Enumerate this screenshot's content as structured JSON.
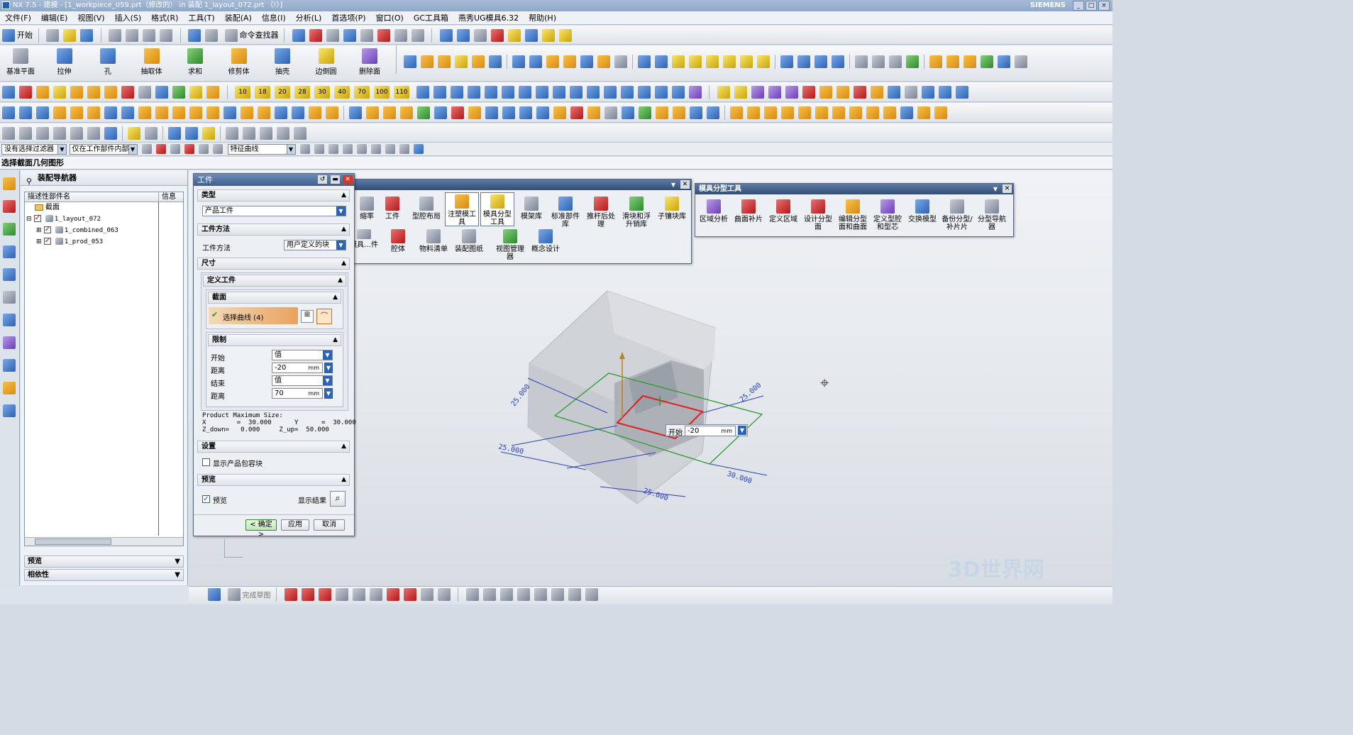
{
  "titlebar": {
    "title": "NX 7.5 - 建模 - [1_workpiece_059.prt（修改的） in 装配 1_layout_072.prt （!）]",
    "brand": "SIEMENS"
  },
  "menubar": [
    "文件(F)",
    "编辑(E)",
    "视图(V)",
    "插入(S)",
    "格式(R)",
    "工具(T)",
    "装配(A)",
    "信息(I)",
    "分析(L)",
    "首选项(P)",
    "窗口(O)",
    "GC工具箱",
    "燕秀UG模具6.32",
    "帮助(H)"
  ],
  "toolbar1": {
    "start": "开始",
    "command_finder": "命令查找器"
  },
  "toolbar2": {
    "items": [
      "基准平面",
      "拉伸",
      "孔",
      "抽取体",
      "求和",
      "修剪体",
      "抽壳",
      "边倒圆",
      "删除面"
    ]
  },
  "toolbar3": {
    "numbers": [
      "10",
      "18",
      "20",
      "28",
      "30",
      "40",
      "70",
      "100",
      "110"
    ]
  },
  "selbar": {
    "filter": "没有选择过滤器",
    "scope": "仅在工作部件内部",
    "curve_rule": "特征曲线"
  },
  "cue": "选择截面几何图形",
  "navigator": {
    "title": "装配导航器",
    "col_name": "描述性部件名",
    "col_info": "信息",
    "rows": [
      "截面",
      "1_layout_072",
      "1_combined_063",
      "1_prod_053"
    ],
    "panel1": "预览",
    "panel2": "相依性"
  },
  "dialog": {
    "title": "工件",
    "sec_type": "类型",
    "type_value": "产品工件",
    "sec_method": "工件方法",
    "method_label": "工件方法",
    "method_value": "用户定义的块",
    "sec_size": "尺寸",
    "sec_define": "定义工件",
    "sec_section": "截面",
    "select_curve": "选择曲线 (4)",
    "sec_limit": "限制",
    "start_label": "开始",
    "start_value": "值",
    "dist1_label": "距离",
    "dist1_value": "-20",
    "unit": "mm",
    "end_label": "结束",
    "end_value": "值",
    "dist2_label": "距离",
    "dist2_value": "70",
    "info_line1": "Product Maximum Size:",
    "info_line2": "X        =  30.000      Y      =  30.000",
    "info_line3": "Z_down=   0.000     Z_up=  50.000",
    "sec_settings": "设置",
    "show_box": "显示产品包容块",
    "sec_preview": "预览",
    "preview": "预览",
    "show_result": "显示结果",
    "ok": "< 确定 >",
    "apply": "应用",
    "cancel": "取消"
  },
  "moldwizard": {
    "row1": [
      "缩率",
      "工件",
      "型腔布局",
      "注塑模工具",
      "模具分型工具",
      "模架库",
      "标准部件库",
      "推杆后处理",
      "滑块和浮升销库",
      "子镶块库"
    ],
    "row2": [
      "模具…件",
      "腔体",
      "物料清单",
      "装配图纸",
      "视图管理器",
      "概念设计"
    ]
  },
  "parting": {
    "title": "模具分型工具",
    "items": [
      "区域分析",
      "曲面补片",
      "定义区域",
      "设计分型面",
      "编辑分型面和曲面",
      "定义型腔和型芯",
      "交换模型",
      "备份分型/补片片",
      "分型导航器"
    ]
  },
  "viewport": {
    "start_label": "开始",
    "start_value": "-20",
    "unit": "mm",
    "dims": [
      "25.000",
      "25.000",
      "30.000",
      "25.000",
      "25.000"
    ]
  },
  "bottom": {
    "finish_sketch": "完成草图"
  },
  "watermark": "3D世界网",
  "colors": {
    "title_blue": "#3e5f8f",
    "accent_red": "#e02020",
    "green_plane": "#2e9b2e",
    "dim_blue": "#2a3fbf"
  }
}
